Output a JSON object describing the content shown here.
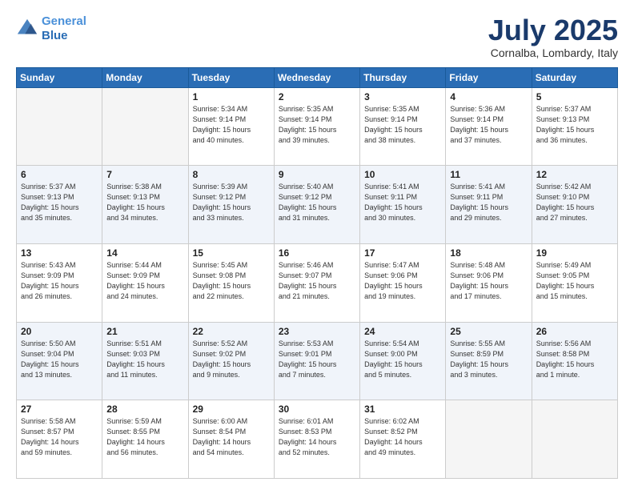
{
  "header": {
    "logo_line1": "General",
    "logo_line2": "Blue",
    "month": "July 2025",
    "location": "Cornalba, Lombardy, Italy"
  },
  "weekdays": [
    "Sunday",
    "Monday",
    "Tuesday",
    "Wednesday",
    "Thursday",
    "Friday",
    "Saturday"
  ],
  "weeks": [
    [
      {
        "day": "",
        "info": ""
      },
      {
        "day": "",
        "info": ""
      },
      {
        "day": "1",
        "info": "Sunrise: 5:34 AM\nSunset: 9:14 PM\nDaylight: 15 hours\nand 40 minutes."
      },
      {
        "day": "2",
        "info": "Sunrise: 5:35 AM\nSunset: 9:14 PM\nDaylight: 15 hours\nand 39 minutes."
      },
      {
        "day": "3",
        "info": "Sunrise: 5:35 AM\nSunset: 9:14 PM\nDaylight: 15 hours\nand 38 minutes."
      },
      {
        "day": "4",
        "info": "Sunrise: 5:36 AM\nSunset: 9:14 PM\nDaylight: 15 hours\nand 37 minutes."
      },
      {
        "day": "5",
        "info": "Sunrise: 5:37 AM\nSunset: 9:13 PM\nDaylight: 15 hours\nand 36 minutes."
      }
    ],
    [
      {
        "day": "6",
        "info": "Sunrise: 5:37 AM\nSunset: 9:13 PM\nDaylight: 15 hours\nand 35 minutes."
      },
      {
        "day": "7",
        "info": "Sunrise: 5:38 AM\nSunset: 9:13 PM\nDaylight: 15 hours\nand 34 minutes."
      },
      {
        "day": "8",
        "info": "Sunrise: 5:39 AM\nSunset: 9:12 PM\nDaylight: 15 hours\nand 33 minutes."
      },
      {
        "day": "9",
        "info": "Sunrise: 5:40 AM\nSunset: 9:12 PM\nDaylight: 15 hours\nand 31 minutes."
      },
      {
        "day": "10",
        "info": "Sunrise: 5:41 AM\nSunset: 9:11 PM\nDaylight: 15 hours\nand 30 minutes."
      },
      {
        "day": "11",
        "info": "Sunrise: 5:41 AM\nSunset: 9:11 PM\nDaylight: 15 hours\nand 29 minutes."
      },
      {
        "day": "12",
        "info": "Sunrise: 5:42 AM\nSunset: 9:10 PM\nDaylight: 15 hours\nand 27 minutes."
      }
    ],
    [
      {
        "day": "13",
        "info": "Sunrise: 5:43 AM\nSunset: 9:09 PM\nDaylight: 15 hours\nand 26 minutes."
      },
      {
        "day": "14",
        "info": "Sunrise: 5:44 AM\nSunset: 9:09 PM\nDaylight: 15 hours\nand 24 minutes."
      },
      {
        "day": "15",
        "info": "Sunrise: 5:45 AM\nSunset: 9:08 PM\nDaylight: 15 hours\nand 22 minutes."
      },
      {
        "day": "16",
        "info": "Sunrise: 5:46 AM\nSunset: 9:07 PM\nDaylight: 15 hours\nand 21 minutes."
      },
      {
        "day": "17",
        "info": "Sunrise: 5:47 AM\nSunset: 9:06 PM\nDaylight: 15 hours\nand 19 minutes."
      },
      {
        "day": "18",
        "info": "Sunrise: 5:48 AM\nSunset: 9:06 PM\nDaylight: 15 hours\nand 17 minutes."
      },
      {
        "day": "19",
        "info": "Sunrise: 5:49 AM\nSunset: 9:05 PM\nDaylight: 15 hours\nand 15 minutes."
      }
    ],
    [
      {
        "day": "20",
        "info": "Sunrise: 5:50 AM\nSunset: 9:04 PM\nDaylight: 15 hours\nand 13 minutes."
      },
      {
        "day": "21",
        "info": "Sunrise: 5:51 AM\nSunset: 9:03 PM\nDaylight: 15 hours\nand 11 minutes."
      },
      {
        "day": "22",
        "info": "Sunrise: 5:52 AM\nSunset: 9:02 PM\nDaylight: 15 hours\nand 9 minutes."
      },
      {
        "day": "23",
        "info": "Sunrise: 5:53 AM\nSunset: 9:01 PM\nDaylight: 15 hours\nand 7 minutes."
      },
      {
        "day": "24",
        "info": "Sunrise: 5:54 AM\nSunset: 9:00 PM\nDaylight: 15 hours\nand 5 minutes."
      },
      {
        "day": "25",
        "info": "Sunrise: 5:55 AM\nSunset: 8:59 PM\nDaylight: 15 hours\nand 3 minutes."
      },
      {
        "day": "26",
        "info": "Sunrise: 5:56 AM\nSunset: 8:58 PM\nDaylight: 15 hours\nand 1 minute."
      }
    ],
    [
      {
        "day": "27",
        "info": "Sunrise: 5:58 AM\nSunset: 8:57 PM\nDaylight: 14 hours\nand 59 minutes."
      },
      {
        "day": "28",
        "info": "Sunrise: 5:59 AM\nSunset: 8:55 PM\nDaylight: 14 hours\nand 56 minutes."
      },
      {
        "day": "29",
        "info": "Sunrise: 6:00 AM\nSunset: 8:54 PM\nDaylight: 14 hours\nand 54 minutes."
      },
      {
        "day": "30",
        "info": "Sunrise: 6:01 AM\nSunset: 8:53 PM\nDaylight: 14 hours\nand 52 minutes."
      },
      {
        "day": "31",
        "info": "Sunrise: 6:02 AM\nSunset: 8:52 PM\nDaylight: 14 hours\nand 49 minutes."
      },
      {
        "day": "",
        "info": ""
      },
      {
        "day": "",
        "info": ""
      }
    ]
  ]
}
